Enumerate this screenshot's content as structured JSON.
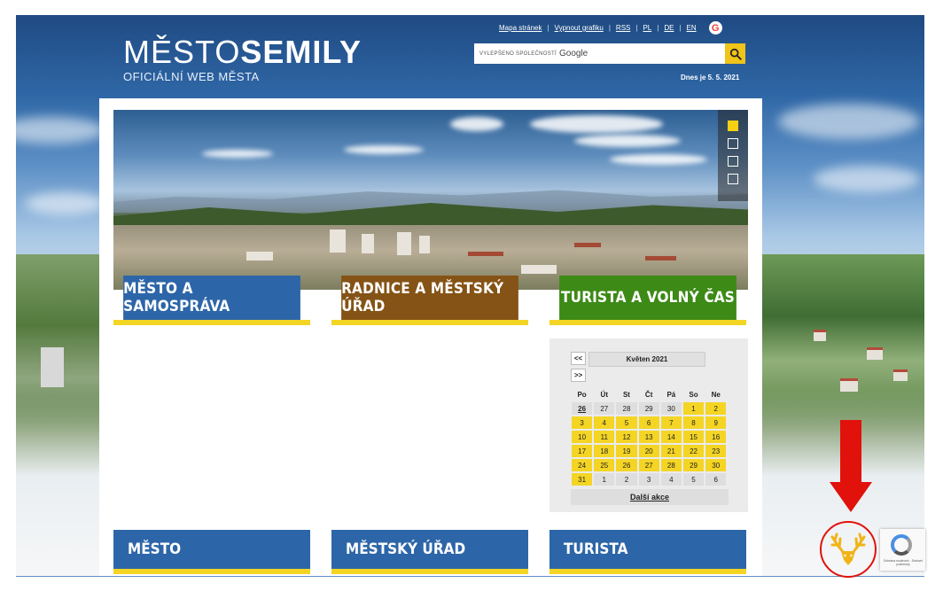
{
  "header": {
    "logo_light": "MĚSTO",
    "logo_bold": "SEMILY",
    "logo_subtitle": "OFICIÁLNÍ WEB MĚSTA",
    "top_links": [
      "Mapa stránek",
      "Vypnout grafiku",
      "RSS",
      "PL",
      "DE",
      "EN"
    ],
    "search_branding_small": "VYLEPŠENO SPOLEČNOSTÍ",
    "search_branding_google": "Google",
    "search_icon": "search-icon",
    "date_text": "Dnes je 5. 5. 2021"
  },
  "slider": {
    "dots": 4,
    "active_index": 0
  },
  "categories": [
    {
      "label": "MĚSTO A SAMOSPRÁVA",
      "color": "#2d66a8"
    },
    {
      "label": "RADNICE A MĚSTSKÝ ÚŘAD",
      "color": "#855316"
    },
    {
      "label": "TURISTA A VOLNÝ ČAS",
      "color": "#3d8a17"
    }
  ],
  "calendar": {
    "prev": "<<",
    "next": ">>",
    "month": "Květen 2021",
    "day_headers": [
      "Po",
      "Út",
      "St",
      "Čt",
      "Pá",
      "So",
      "Ne"
    ],
    "weeks": [
      [
        "26",
        "27",
        "28",
        "29",
        "30",
        "1",
        "2"
      ],
      [
        "3",
        "4",
        "5",
        "6",
        "7",
        "8",
        "9"
      ],
      [
        "10",
        "11",
        "12",
        "13",
        "14",
        "15",
        "16"
      ],
      [
        "17",
        "18",
        "19",
        "20",
        "21",
        "22",
        "23"
      ],
      [
        "24",
        "25",
        "26",
        "27",
        "28",
        "29",
        "30"
      ],
      [
        "31",
        "1",
        "2",
        "3",
        "4",
        "5",
        "6"
      ]
    ],
    "more_events": "Další akce"
  },
  "sections": [
    {
      "label": "MĚSTO"
    },
    {
      "label": "MĚSTSKÝ ÚŘAD"
    },
    {
      "label": "TURISTA"
    }
  ],
  "overlay": {
    "annotation_arrow_color": "#e1110b",
    "deer_icon": "deer-antlers-icon",
    "recaptcha_text": "Ochrana soukromí - Smluvní podmínky"
  }
}
